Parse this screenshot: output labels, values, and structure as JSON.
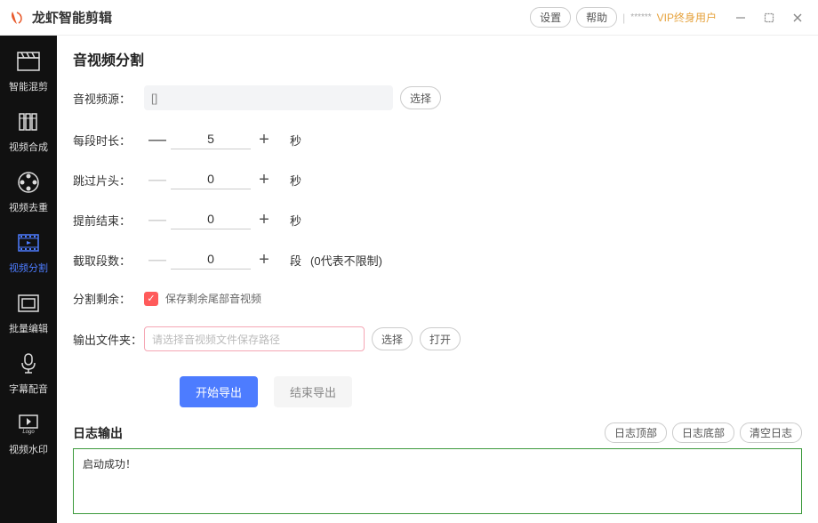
{
  "titlebar": {
    "app_title": "龙虾智能剪辑",
    "settings": "设置",
    "help": "帮助",
    "stars": "******",
    "vip": "VIP终身用户"
  },
  "sidebar": {
    "items": [
      {
        "label": "智能混剪"
      },
      {
        "label": "视频合成"
      },
      {
        "label": "视频去重"
      },
      {
        "label": "视频分割"
      },
      {
        "label": "批量编辑"
      },
      {
        "label": "字幕配音"
      },
      {
        "label": "视频水印"
      }
    ]
  },
  "page": {
    "title": "音视频分割",
    "source_label": "音视频源：",
    "source_value": "[]",
    "select_btn": "选择",
    "open_btn": "打开",
    "seg_len_label": "每段时长：",
    "seg_len_value": "5",
    "seg_len_unit": "秒",
    "skip_head_label": "跳过片头：",
    "skip_head_value": "0",
    "skip_head_unit": "秒",
    "early_end_label": "提前结束：",
    "early_end_value": "0",
    "early_end_unit": "秒",
    "count_label": "截取段数：",
    "count_value": "0",
    "count_unit": "段",
    "count_hint": "(0代表不限制)",
    "remain_label": "分割剩余：",
    "remain_check_label": "保存剩余尾部音视频",
    "output_label": "输出文件夹：",
    "output_placeholder": "请选择音视频文件保存路径",
    "start_export": "开始导出",
    "end_export": "结束导出"
  },
  "log": {
    "title": "日志输出",
    "top_btn": "日志顶部",
    "bottom_btn": "日志底部",
    "clear_btn": "清空日志",
    "content": "启动成功！"
  }
}
